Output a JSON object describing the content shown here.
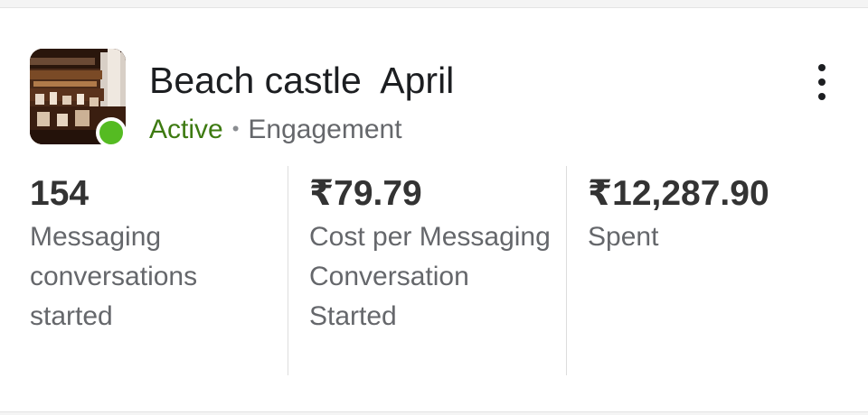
{
  "campaign": {
    "title": "Beach castle  April",
    "status": "Active",
    "separator": "•",
    "objective": "Engagement",
    "thumbnail_icon": "campaign-thumbnail-image",
    "status_color": "#55bb22"
  },
  "menu": {
    "icon": "more-vertical-icon"
  },
  "metrics": [
    {
      "value": "154",
      "label": "Messaging conversations started"
    },
    {
      "value": "₹79.79",
      "label": "Cost per Messaging Conversation Started"
    },
    {
      "value": "₹12,287.90",
      "label": "Spent"
    }
  ],
  "colors": {
    "active_text": "#3d7a11",
    "secondary_text": "#65676b",
    "value_text": "#333333"
  }
}
